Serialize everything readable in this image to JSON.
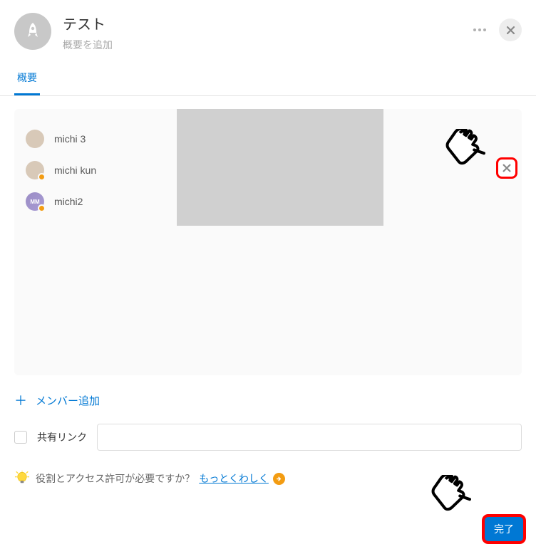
{
  "header": {
    "title": "テスト",
    "subtitle": "概要を追加"
  },
  "tabs": {
    "overview": "概要"
  },
  "members": [
    {
      "name": "michi 3",
      "avatar_type": "photo",
      "has_badge": false
    },
    {
      "name": "michi kun",
      "avatar_type": "photo",
      "has_badge": true
    },
    {
      "name": "michi2",
      "avatar_type": "initials",
      "initials": "MM",
      "has_badge": true
    }
  ],
  "add_member_label": "メンバー追加",
  "share": {
    "label": "共有リンク",
    "value": ""
  },
  "footer": {
    "question": "役割とアクセス許可が必要ですか？",
    "link": "もっとくわしく"
  },
  "done_label": "完了"
}
